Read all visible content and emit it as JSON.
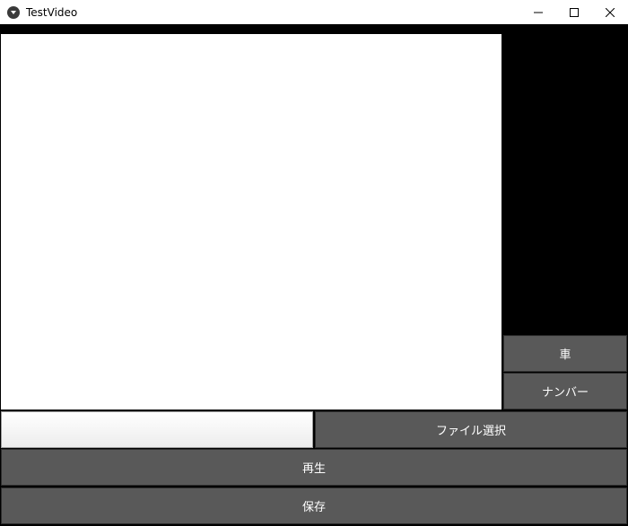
{
  "window": {
    "title": "TestVideo",
    "controls": {
      "minimize_icon": "minimize-icon",
      "maximize_icon": "maximize-icon",
      "close_icon": "close-icon"
    }
  },
  "side_buttons": {
    "car_label": "車",
    "number_label": "ナンバー"
  },
  "file_row": {
    "input_value": "",
    "select_label": "ファイル選択"
  },
  "actions": {
    "play_label": "再生",
    "save_label": "保存"
  },
  "colors": {
    "button_bg": "#595959",
    "button_text": "#ffffff",
    "window_bg": "#000000",
    "video_bg": "#ffffff"
  }
}
